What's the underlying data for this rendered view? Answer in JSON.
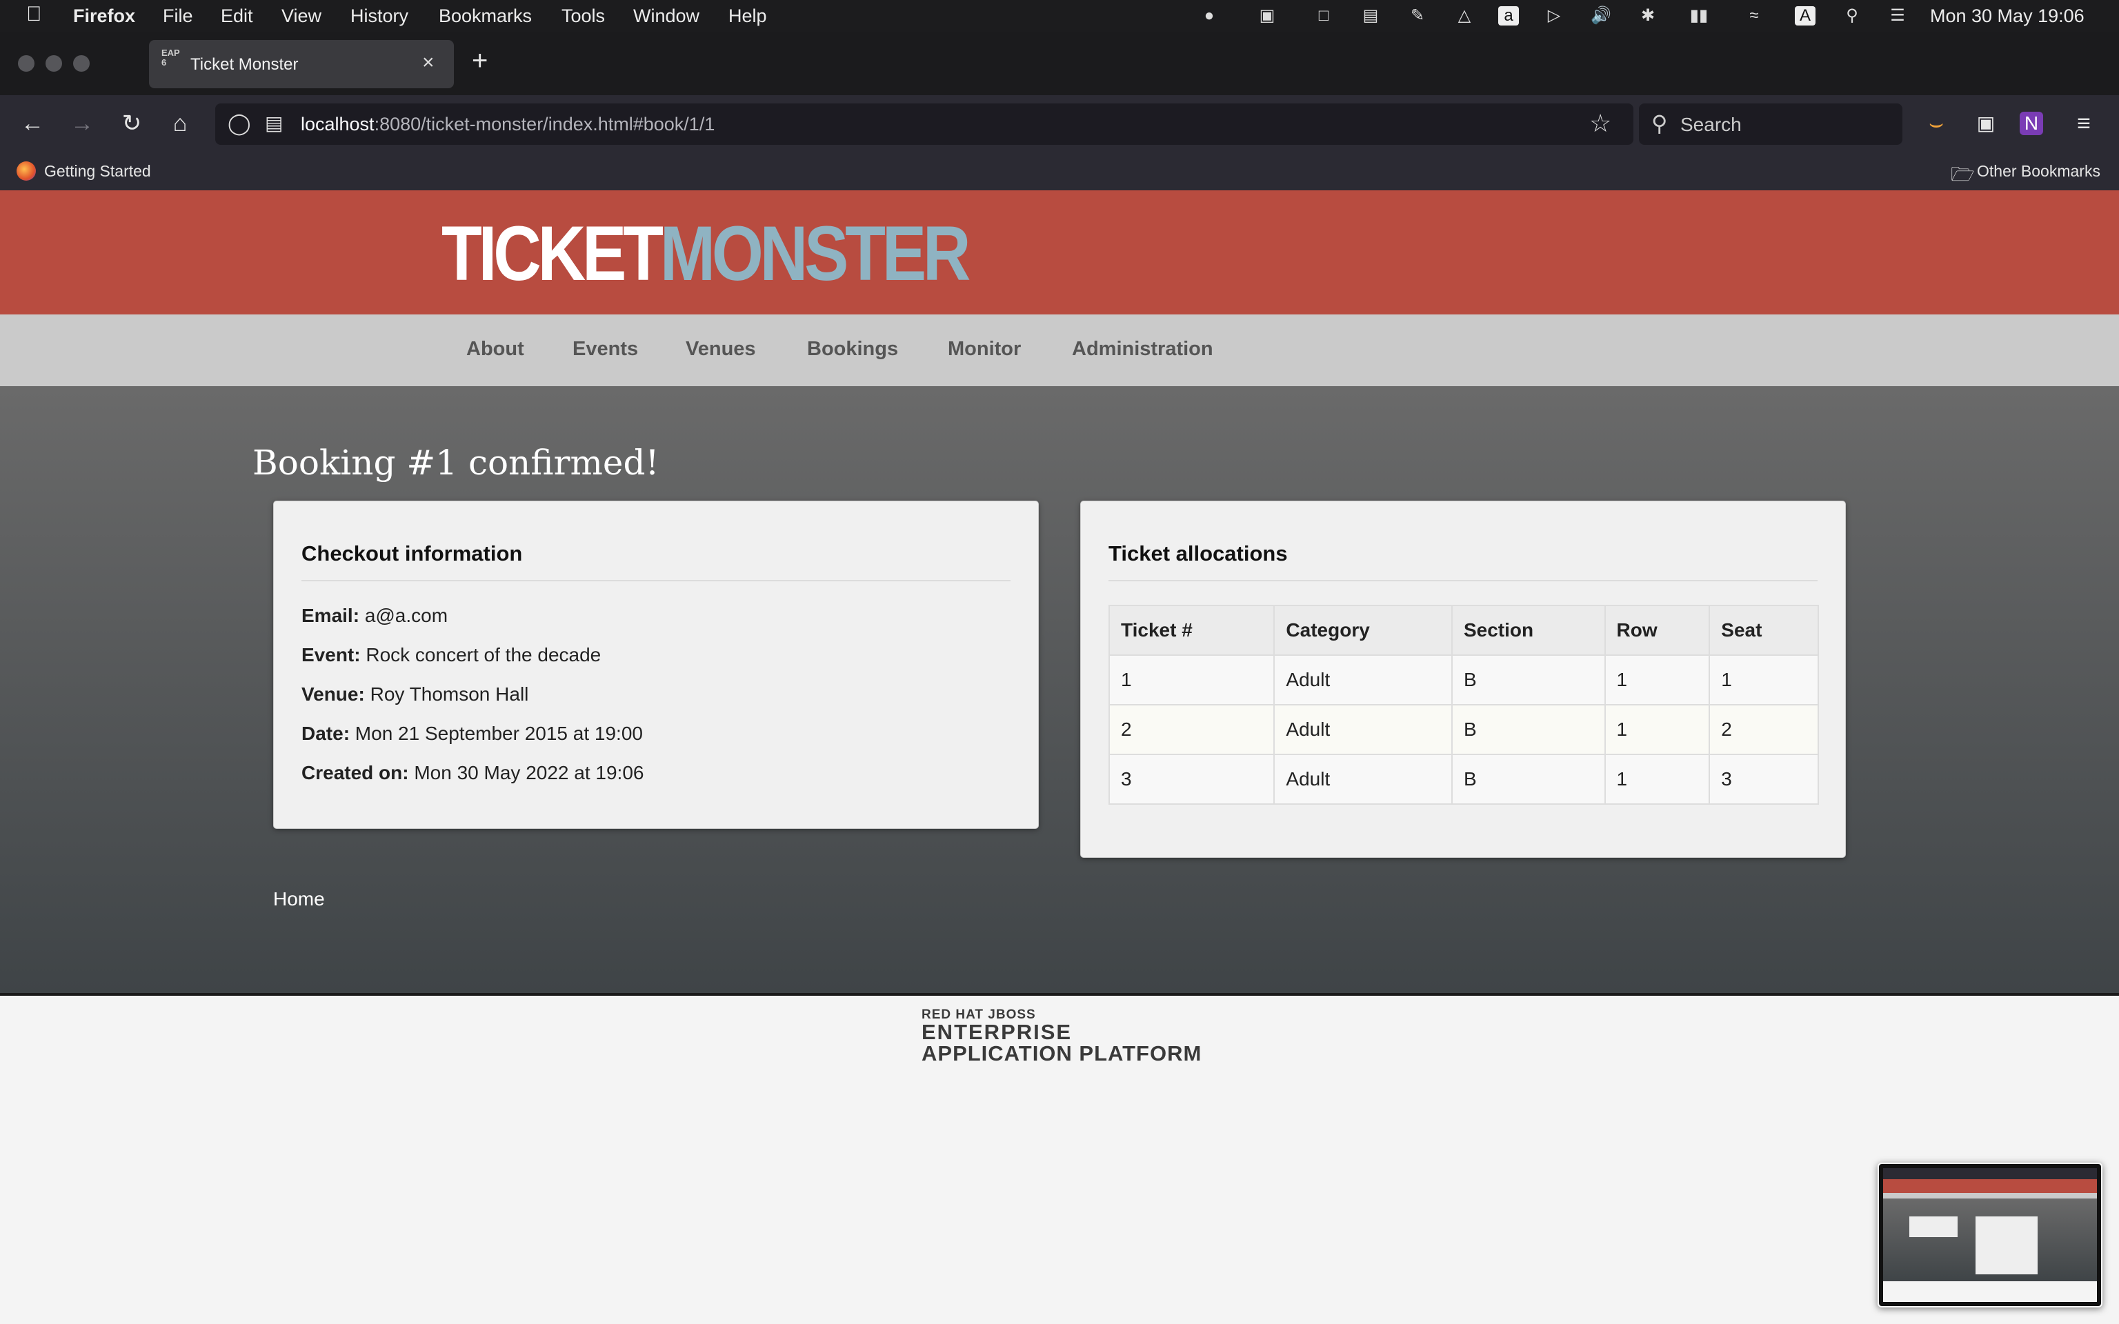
{
  "os_menubar": {
    "app": "Firefox",
    "items": [
      "File",
      "Edit",
      "View",
      "History",
      "Bookmarks",
      "Tools",
      "Window",
      "Help"
    ],
    "datetime": "Mon 30 May  19:06"
  },
  "browser": {
    "tab_title": "Ticket Monster",
    "tab_favicon_text": "EAP 6",
    "url_host": "localhost",
    "url_rest": ":8080/ticket-monster/index.html#book/1/1",
    "search_placeholder": "Search",
    "bookmark_left": "Getting Started",
    "bookmark_right": "Other Bookmarks"
  },
  "site": {
    "logo_part1": "TICKET",
    "logo_part2": "MONSTER",
    "nav": [
      "About",
      "Events",
      "Venues",
      "Bookings",
      "Monitor",
      "Administration"
    ],
    "page_title": "Booking #1 confirmed!",
    "checkout": {
      "title": "Checkout information",
      "rows": [
        {
          "label": "Email:",
          "value": "a@a.com"
        },
        {
          "label": "Event:",
          "value": "Rock concert of the decade"
        },
        {
          "label": "Venue:",
          "value": "Roy Thomson Hall"
        },
        {
          "label": "Date:",
          "value": "Mon 21 September 2015 at 19:00"
        },
        {
          "label": "Created on:",
          "value": "Mon 30 May 2022 at 19:06"
        }
      ]
    },
    "tickets": {
      "title": "Ticket allocations",
      "columns": [
        "Ticket #",
        "Category",
        "Section",
        "Row",
        "Seat"
      ],
      "rows": [
        [
          "1",
          "Adult",
          "B",
          "1",
          "1"
        ],
        [
          "2",
          "Adult",
          "B",
          "1",
          "2"
        ],
        [
          "3",
          "Adult",
          "B",
          "1",
          "3"
        ]
      ]
    },
    "home_link": "Home",
    "footer_line1": "RED HAT JBOSS",
    "footer_line2": "ENTERPRISE",
    "footer_line3": "APPLICATION PLATFORM"
  },
  "colors": {
    "header_red": "#b84c40",
    "logo_blue": "#8fb3c2",
    "nav_grey": "#cacaca"
  }
}
